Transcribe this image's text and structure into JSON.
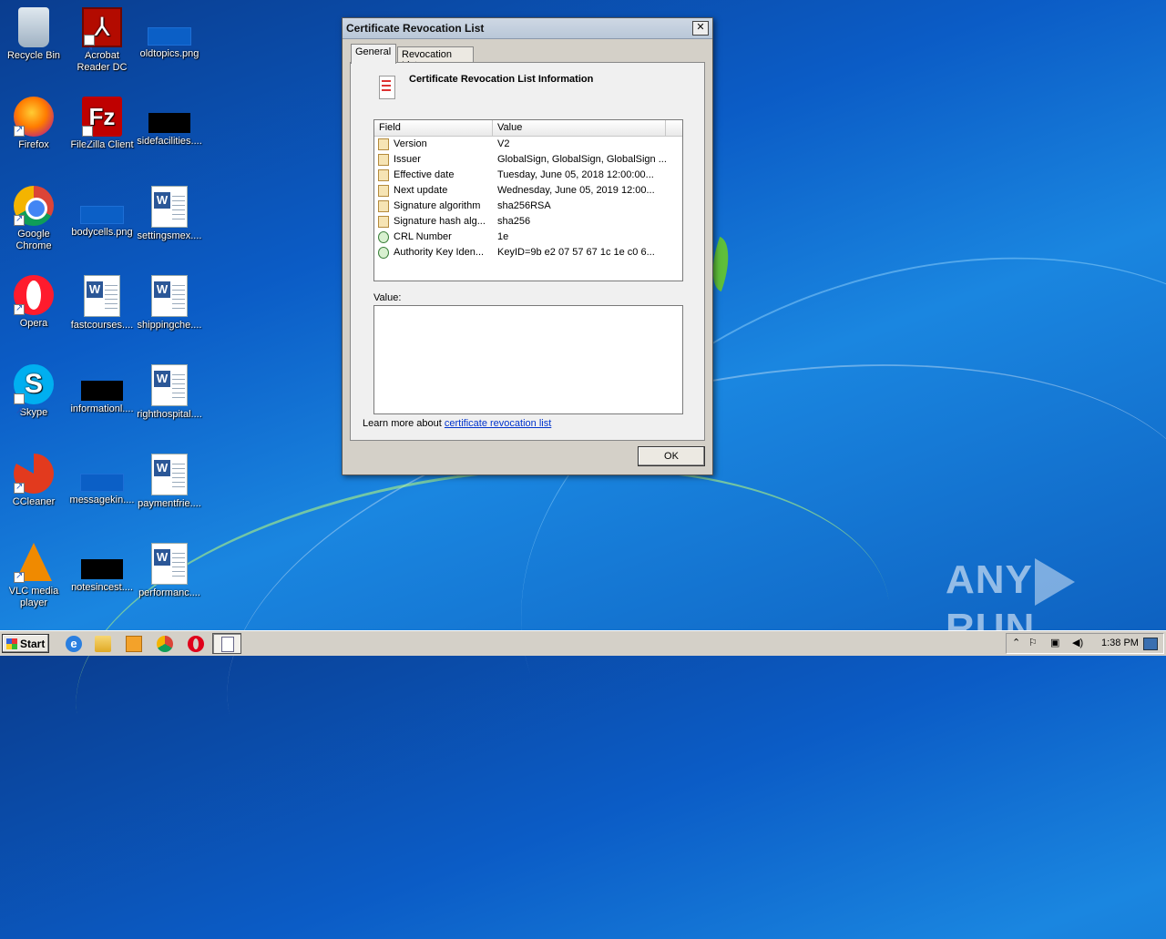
{
  "desktop": {
    "icons": [
      {
        "label": "Recycle Bin",
        "icon": "recycle-bin-icon"
      },
      {
        "label": "Acrobat Reader DC",
        "icon": "acrobat-icon"
      },
      {
        "label": "oldtopics.png",
        "icon": "image-file-icon"
      },
      {
        "label": "Firefox",
        "icon": "firefox-icon"
      },
      {
        "label": "FileZilla Client",
        "icon": "filezilla-icon"
      },
      {
        "label": "sidefacilities....",
        "icon": "black-file-icon"
      },
      {
        "label": "Google Chrome",
        "icon": "chrome-icon"
      },
      {
        "label": "bodycells.png",
        "icon": "image-file-icon"
      },
      {
        "label": "settingsmex....",
        "icon": "word-document-icon"
      },
      {
        "label": "Opera",
        "icon": "opera-icon"
      },
      {
        "label": "fastcourses....",
        "icon": "word-document-icon"
      },
      {
        "label": "shippingche....",
        "icon": "word-document-icon"
      },
      {
        "label": "Skype",
        "icon": "skype-icon"
      },
      {
        "label": "informationl....",
        "icon": "black-file-icon"
      },
      {
        "label": "righthospital....",
        "icon": "word-document-icon"
      },
      {
        "label": "CCleaner",
        "icon": "ccleaner-icon"
      },
      {
        "label": "messagekin....",
        "icon": "image-file-icon"
      },
      {
        "label": "paymentfrie....",
        "icon": "word-document-icon"
      },
      {
        "label": "VLC media player",
        "icon": "vlc-icon"
      },
      {
        "label": "notesincest....",
        "icon": "black-file-icon"
      },
      {
        "label": "performanc....",
        "icon": "word-document-icon"
      }
    ]
  },
  "dialog": {
    "title": "Certificate Revocation List",
    "close_label": "✕",
    "tabs": [
      {
        "label": "General"
      },
      {
        "label": "Revocation List"
      }
    ],
    "active_tab": "General",
    "heading": "Certificate Revocation List Information",
    "columns": [
      "Field",
      "Value"
    ],
    "rows": [
      {
        "field": "Version",
        "value": "V2",
        "icon": "field-icon"
      },
      {
        "field": "Issuer",
        "value": "GlobalSign, GlobalSign, GlobalSign ...",
        "icon": "field-icon"
      },
      {
        "field": "Effective date",
        "value": "Tuesday, June 05, 2018 12:00:00...",
        "icon": "field-icon"
      },
      {
        "field": "Next update",
        "value": "Wednesday, June 05, 2019 12:00...",
        "icon": "field-icon"
      },
      {
        "field": "Signature algorithm",
        "value": "sha256RSA",
        "icon": "field-icon"
      },
      {
        "field": "Signature hash alg...",
        "value": "sha256",
        "icon": "field-icon"
      },
      {
        "field": "CRL Number",
        "value": "1e",
        "icon": "extension-icon"
      },
      {
        "field": "Authority Key Iden...",
        "value": "KeyID=9b e2 07 57 67 1c 1e c0 6...",
        "icon": "extension-icon"
      }
    ],
    "value_label": "Value:",
    "value_text": "",
    "learn_prefix": "Learn more about ",
    "learn_link": "certificate revocation list",
    "ok_label": "OK"
  },
  "taskbar": {
    "start_label": "Start",
    "clock": "1:38 PM"
  },
  "watermark": {
    "left": "ANY",
    "right": "RUN"
  }
}
